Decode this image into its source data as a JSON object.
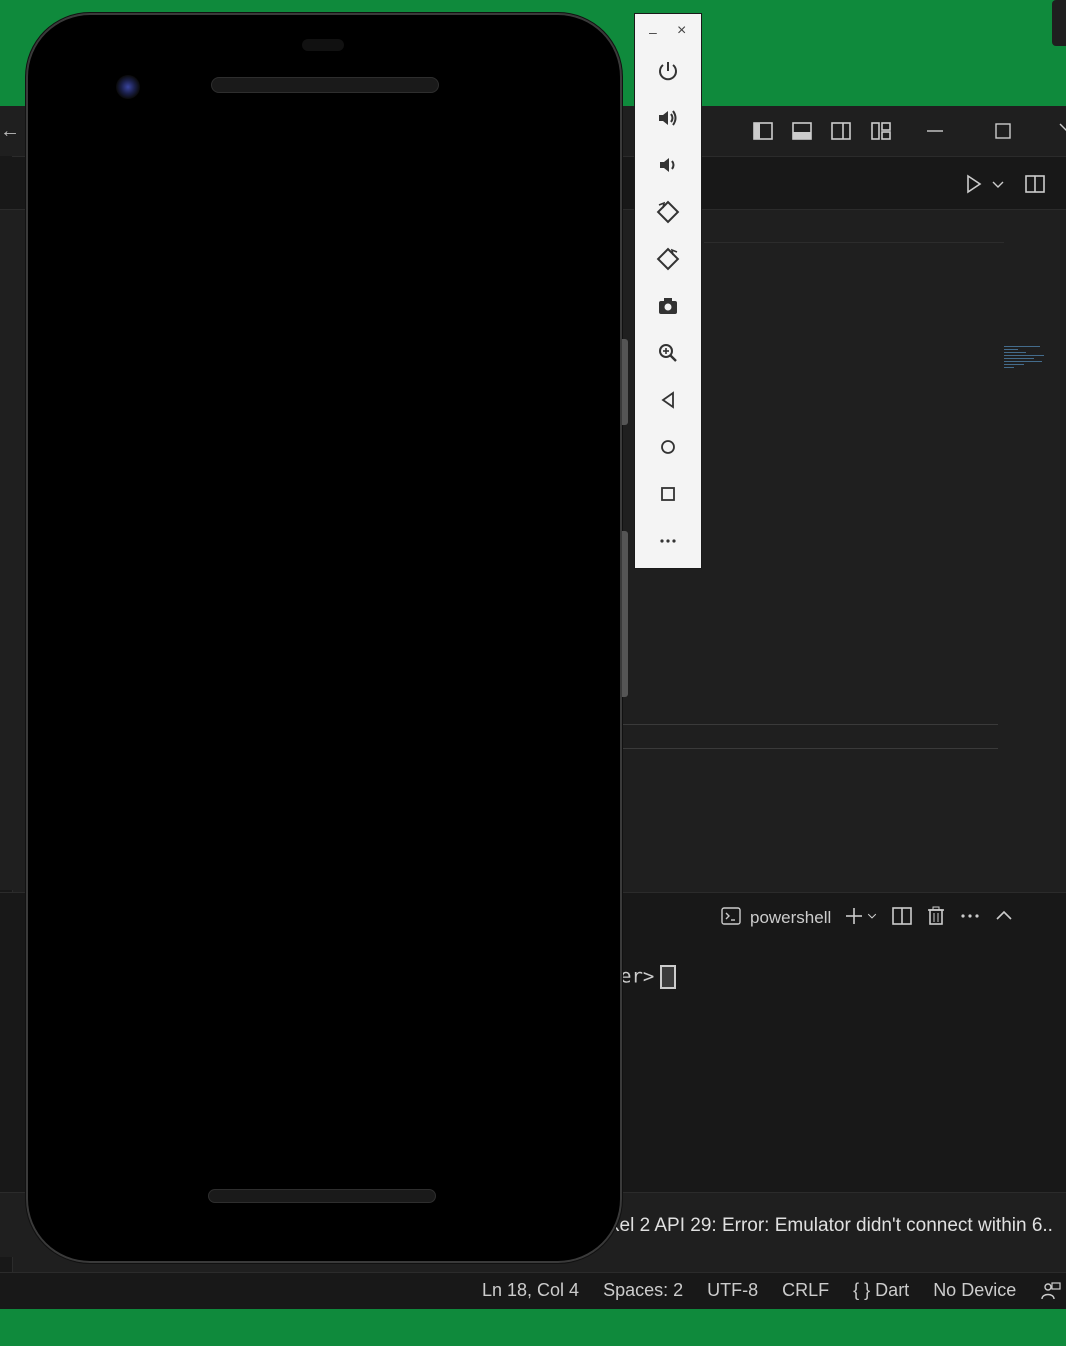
{
  "emulator_toolbar": {
    "minimize_label": "–",
    "close_label": "×",
    "buttons": [
      "power-icon",
      "volume-up-icon",
      "volume-down-icon",
      "rotate-left-icon",
      "rotate-right-icon",
      "camera-icon",
      "zoom-icon",
      "back-icon",
      "home-icon",
      "overview-icon",
      "more-icon"
    ]
  },
  "panel": {
    "terminal_name": "powershell",
    "prompt_text": "er>"
  },
  "notification": {
    "text": "xel 2 API 29: Error: Emulator didn't connect within 6.."
  },
  "statusbar": {
    "position": "Ln 18, Col 4",
    "spaces": "Spaces: 2",
    "encoding": "UTF-8",
    "eol": "CRLF",
    "language": "{ } Dart",
    "device": "No Device"
  },
  "colors": {
    "desktop_bg": "#0f8a3c",
    "editor_bg": "#1f1f1f"
  }
}
